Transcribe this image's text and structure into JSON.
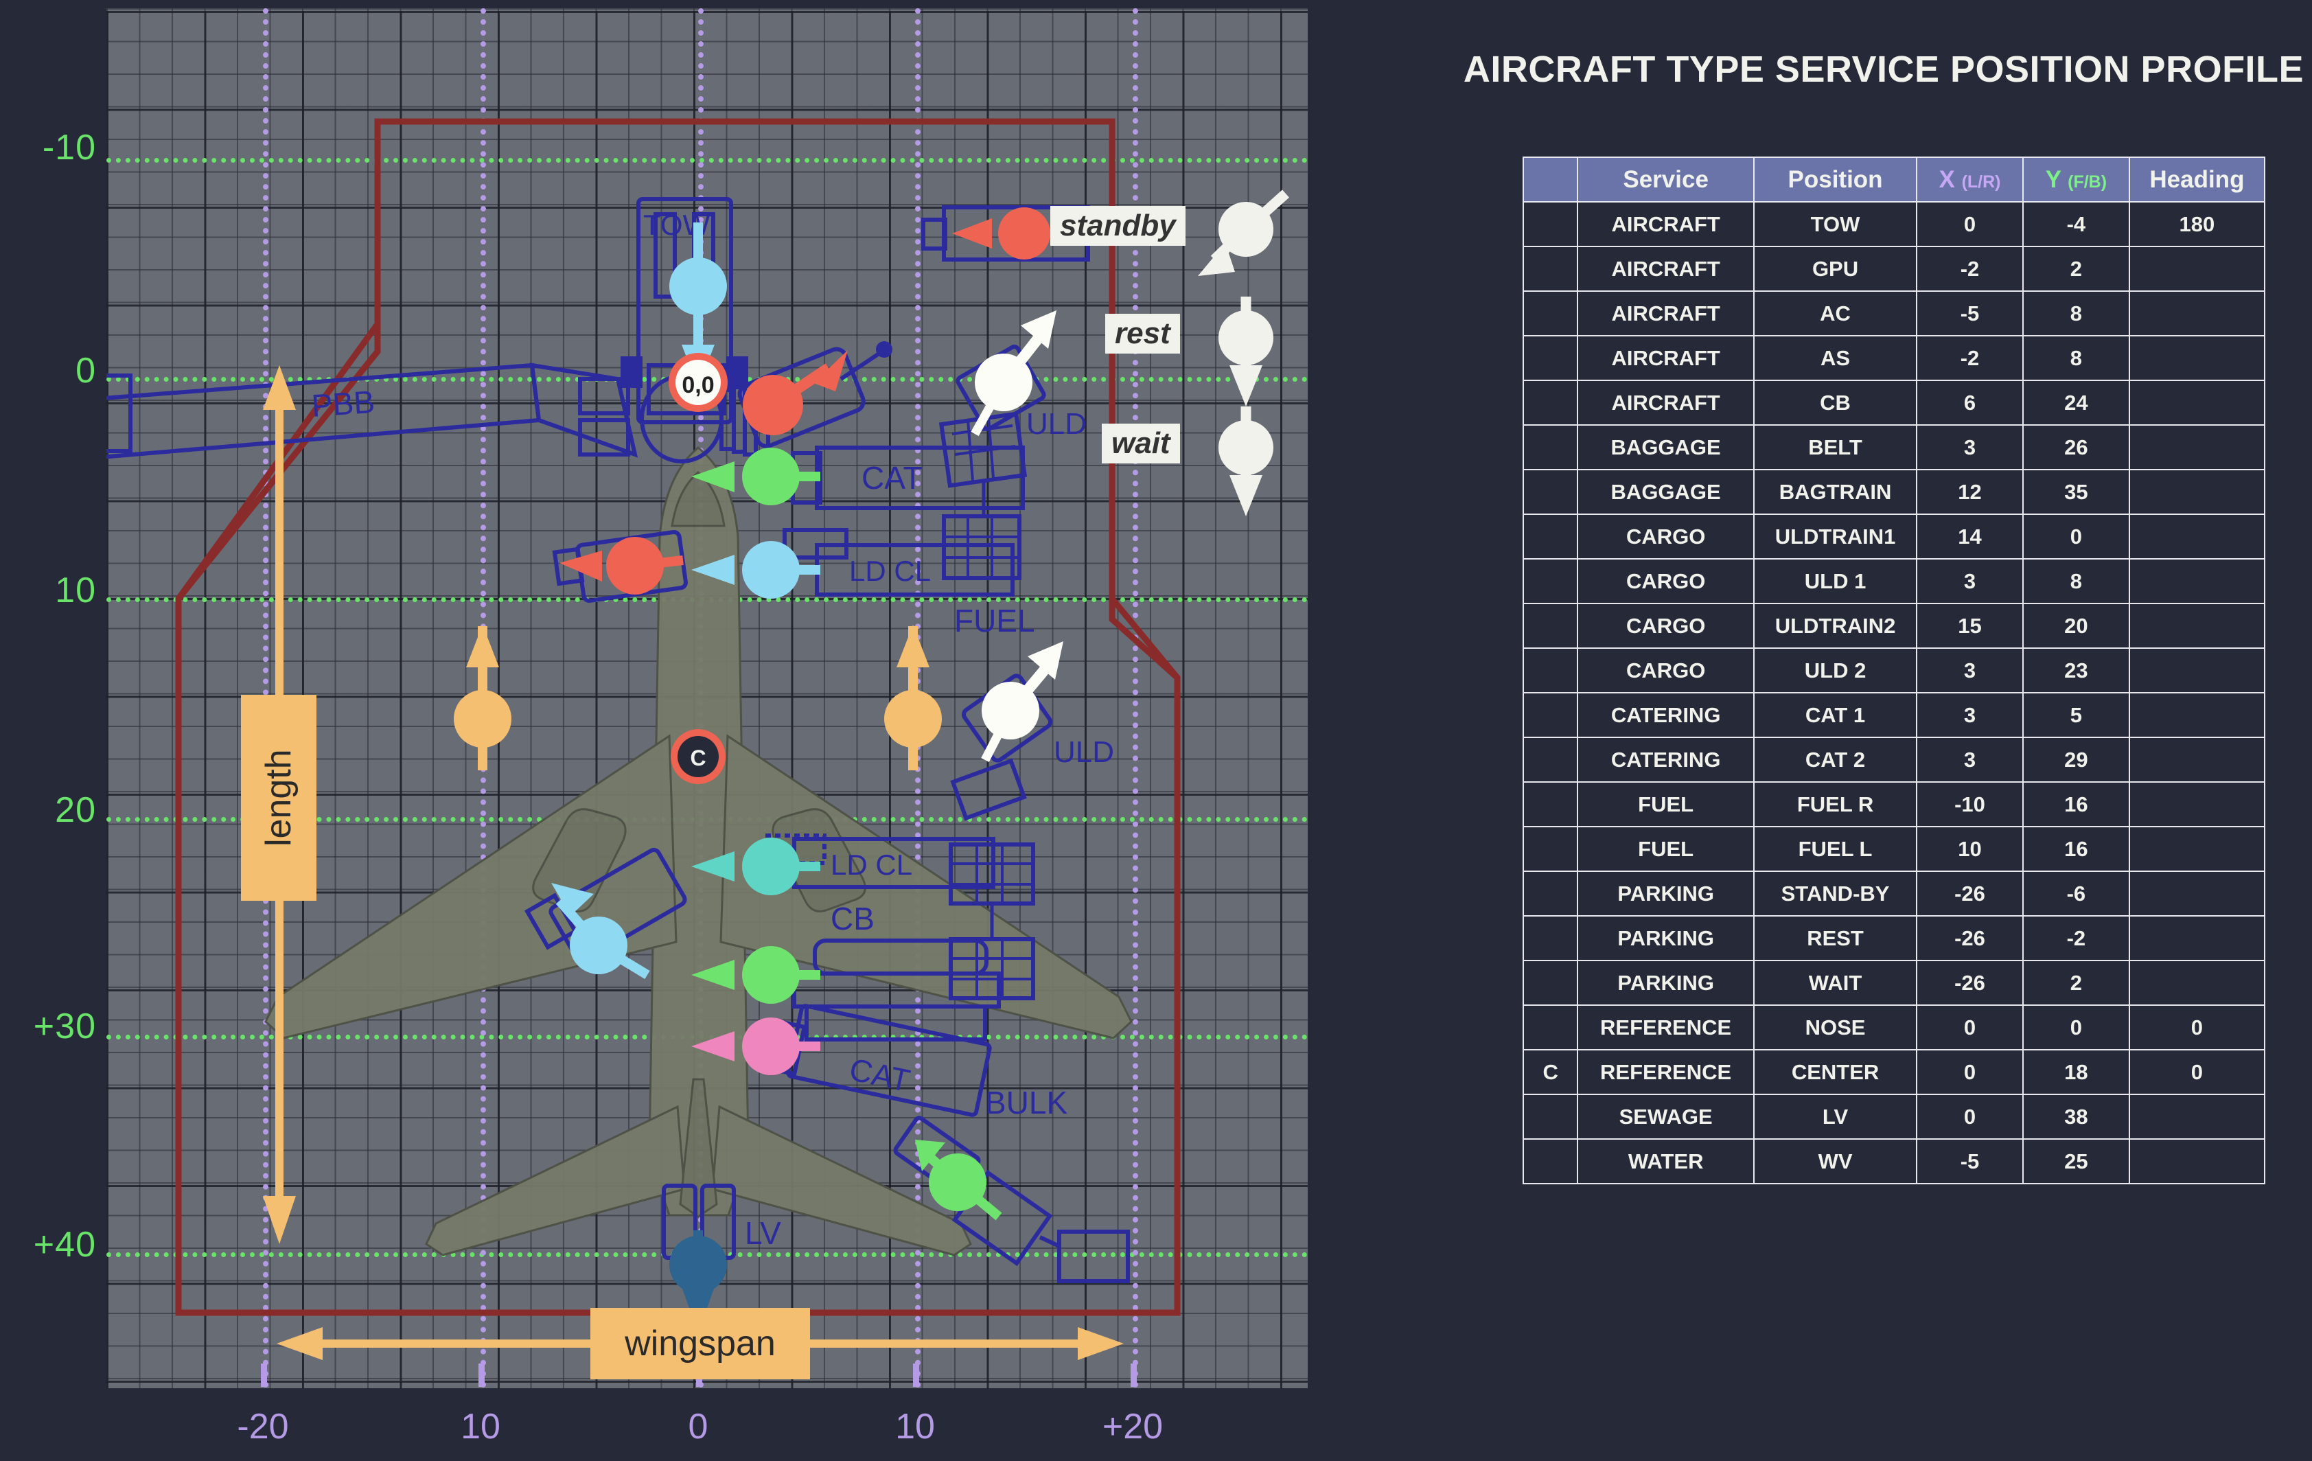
{
  "table": {
    "title": "AIRCRAFT TYPE SERVICE POSITION PROFILE",
    "headers": {
      "index": "",
      "service": "Service",
      "position": "Position",
      "x": "X",
      "x_sub": "(L/R)",
      "y": "Y",
      "y_sub": "(F/B)",
      "heading": "Heading"
    },
    "rows": [
      {
        "idx": "",
        "service": "AIRCRAFT",
        "position": "TOW",
        "x": "0",
        "y": "-4",
        "heading": "180"
      },
      {
        "idx": "",
        "service": "AIRCRAFT",
        "position": "GPU",
        "x": "-2",
        "y": "2",
        "heading": ""
      },
      {
        "idx": "",
        "service": "AIRCRAFT",
        "position": "AC",
        "x": "-5",
        "y": "8",
        "heading": ""
      },
      {
        "idx": "",
        "service": "AIRCRAFT",
        "position": "AS",
        "x": "-2",
        "y": "8",
        "heading": ""
      },
      {
        "idx": "",
        "service": "AIRCRAFT",
        "position": "CB",
        "x": "6",
        "y": "24",
        "heading": ""
      },
      {
        "idx": "",
        "service": "BAGGAGE",
        "position": "BELT",
        "x": "3",
        "y": "26",
        "heading": ""
      },
      {
        "idx": "",
        "service": "BAGGAGE",
        "position": "BAGTRAIN",
        "x": "12",
        "y": "35",
        "heading": ""
      },
      {
        "idx": "",
        "service": "CARGO",
        "position": "ULDTRAIN1",
        "x": "14",
        "y": "0",
        "heading": ""
      },
      {
        "idx": "",
        "service": "CARGO",
        "position": "ULD 1",
        "x": "3",
        "y": "8",
        "heading": ""
      },
      {
        "idx": "",
        "service": "CARGO",
        "position": "ULDTRAIN2",
        "x": "15",
        "y": "20",
        "heading": ""
      },
      {
        "idx": "",
        "service": "CARGO",
        "position": "ULD 2",
        "x": "3",
        "y": "23",
        "heading": ""
      },
      {
        "idx": "",
        "service": "CATERING",
        "position": "CAT 1",
        "x": "3",
        "y": "5",
        "heading": ""
      },
      {
        "idx": "",
        "service": "CATERING",
        "position": "CAT 2",
        "x": "3",
        "y": "29",
        "heading": ""
      },
      {
        "idx": "",
        "service": "FUEL",
        "position": "FUEL R",
        "x": "-10",
        "y": "16",
        "heading": ""
      },
      {
        "idx": "",
        "service": "FUEL",
        "position": "FUEL L",
        "x": "10",
        "y": "16",
        "heading": ""
      },
      {
        "idx": "",
        "service": "PARKING",
        "position": "STAND-BY",
        "x": "-26",
        "y": "-6",
        "heading": ""
      },
      {
        "idx": "",
        "service": "PARKING",
        "position": "REST",
        "x": "-26",
        "y": "-2",
        "heading": ""
      },
      {
        "idx": "",
        "service": "PARKING",
        "position": "WAIT",
        "x": "-26",
        "y": "2",
        "heading": ""
      },
      {
        "idx": "",
        "service": "REFERENCE",
        "position": "NOSE",
        "x": "0",
        "y": "0",
        "heading": "0"
      },
      {
        "idx": "C",
        "service": "REFERENCE",
        "position": "CENTER",
        "x": "0",
        "y": "18",
        "heading": "0"
      },
      {
        "idx": "",
        "service": "SEWAGE",
        "position": "LV",
        "x": "0",
        "y": "38",
        "heading": ""
      },
      {
        "idx": "",
        "service": "WATER",
        "position": "WV",
        "x": "-5",
        "y": "25",
        "heading": ""
      }
    ]
  },
  "diagram": {
    "y_axis": {
      "label_color": "#6ae36a",
      "ticks": [
        "-10",
        "0",
        "10",
        "20",
        "+30",
        "+40"
      ]
    },
    "x_axis": {
      "label_color": "#b59ae6",
      "ticks": [
        "-20",
        "10",
        "0",
        "10",
        "+20"
      ]
    },
    "origin_marker": "0,0",
    "center_marker": "C",
    "callouts": {
      "standby": "standby",
      "rest": "rest",
      "wait": "wait"
    },
    "dimensions": {
      "length": "length",
      "wingspan": "wingspan"
    },
    "vehicle_labels": {
      "tow": "TOW",
      "pbb": "PBB",
      "cat_top": "CAT",
      "ld_cl_top": "LD CL",
      "uld_top": "ULD",
      "fuel": "FUEL",
      "uld_mid": "ULD",
      "ld_cl_bottom": "LD CL",
      "cb": "CB",
      "cat_bottom": "CAT",
      "bulk": "BULK",
      "lv": "LV"
    },
    "colors": {
      "plot_background": "#686c75",
      "grid_line": "#2a2c32",
      "y_gridline": "#6ae36a",
      "x_gridline": "#b59ae6",
      "vehicle_outline": "#2b2b9e",
      "aircraft_fill": "#767a69",
      "boundary": "#8a2b2b",
      "dimension": "#f5bf72",
      "accent_red": "#ee6352",
      "accent_green": "#6ee36e",
      "accent_cyan": "#8fd9f2",
      "accent_teal": "#5fd6c5",
      "accent_pink": "#ef86bd",
      "accent_orange": "#f5bf72",
      "accent_white": "#f2f2ec",
      "accent_navy": "#2d6490"
    }
  }
}
